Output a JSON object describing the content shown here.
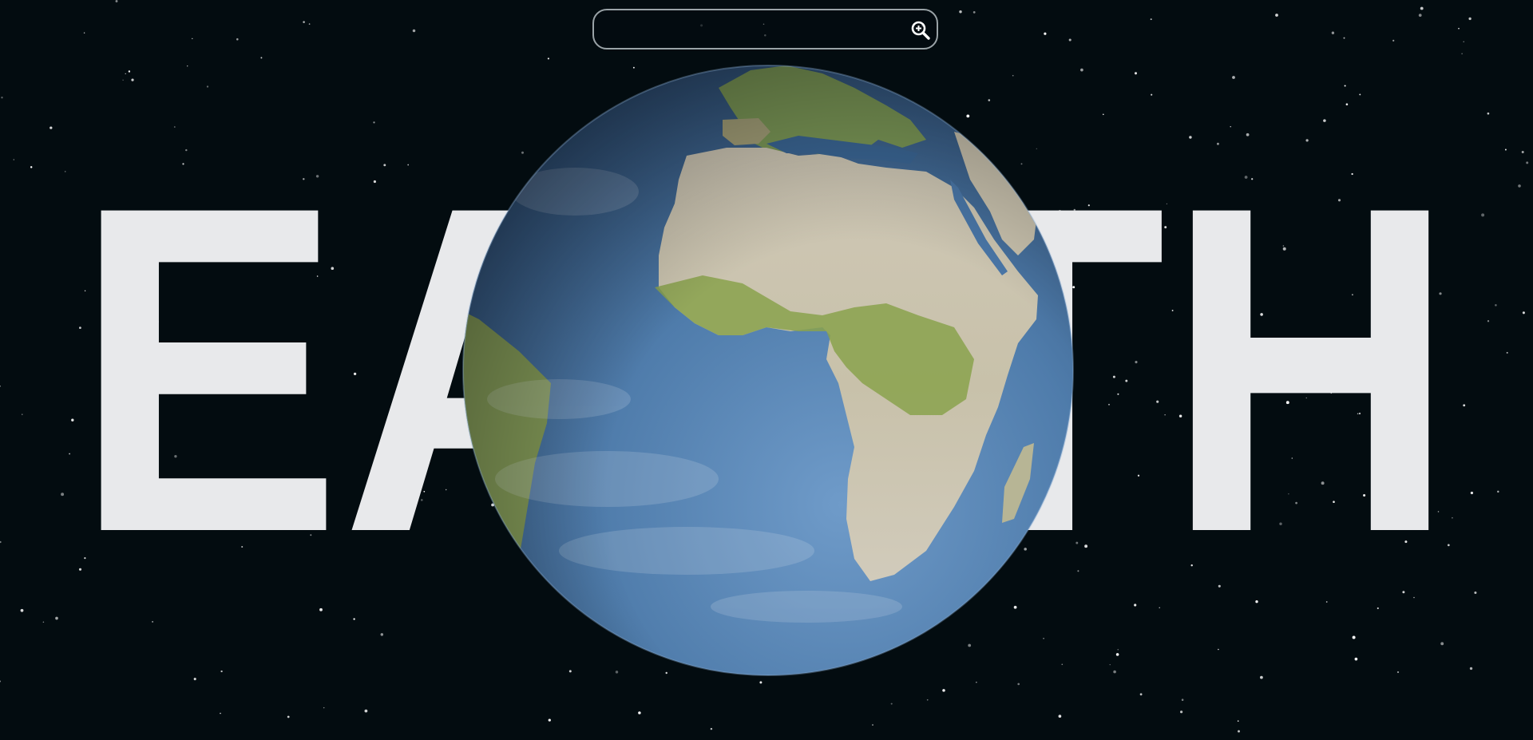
{
  "hero": {
    "title_word": "EARTH",
    "title_color": "#e8e9eb"
  },
  "search": {
    "value": "",
    "placeholder": ""
  },
  "icons": {
    "search_button": "zoom-in-magnifier-icon"
  },
  "colors": {
    "background": "#030c10",
    "ocean": "#4a77a8",
    "land": "#cfc8b6",
    "vegetation": "#8fa14f",
    "search_border": "#9aa3a7"
  }
}
